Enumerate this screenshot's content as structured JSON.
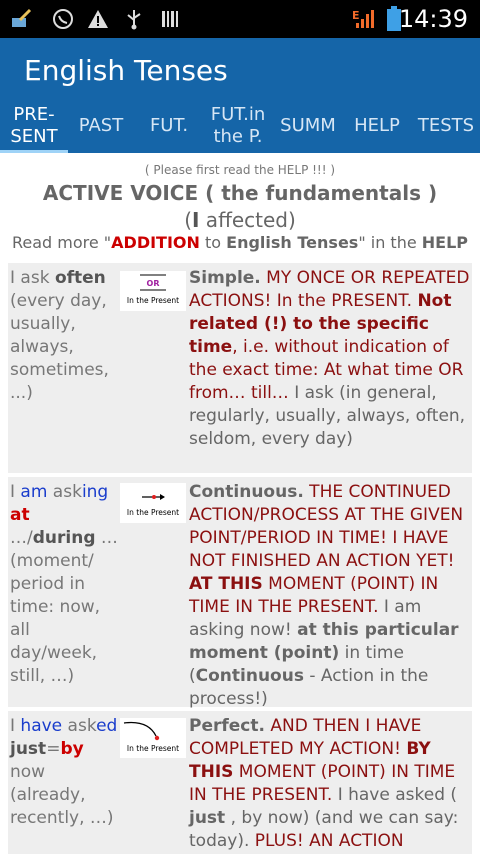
{
  "status_bar": {
    "time": "14:39",
    "icons": [
      "broom-icon",
      "whatsapp-icon",
      "warning-icon",
      "usb-icon",
      "barcode-icon",
      "signal-icon",
      "battery-icon"
    ],
    "network_label": "E"
  },
  "app_bar": {
    "title": "English Tenses",
    "tabs": [
      {
        "label": "PRE-\nSENT",
        "active": true
      },
      {
        "label": "PAST"
      },
      {
        "label": "FUT."
      },
      {
        "label": "FUT.in\nthe P."
      },
      {
        "label": "SUMM"
      },
      {
        "label": "HELP"
      },
      {
        "label": "TESTS"
      }
    ]
  },
  "content": {
    "note": "( Please first read the HELP !!! )",
    "heading": "ACTIVE VOICE ( the fundamentals )",
    "subheading_bold": "I",
    "subheading_rest": " affected)",
    "subheading_open": "(",
    "readmore": {
      "prefix": "Read more \"",
      "addition": "ADDITION",
      "to": " to ",
      "english_tenses": "English Tenses",
      "middle": "\" in the ",
      "help": "HELP"
    },
    "rows": [
      {
        "left_html": [
          "I ask ",
          "often",
          " (every day, usually, always, sometimes, ...)"
        ],
        "illustration_label": "In the Present",
        "illustration_or": "OR",
        "right": {
          "title": "Simple.",
          "text": " MY ONCE OR REPEATED ACTIONS! In the PRESENT. ",
          "bold1": "Not related (!) to the specific time",
          "text2": ", i.e. without indication of the exact time: At what time OR from… till… ",
          "gray": "I ask (in general, regularly, usually, always, often, seldom, every day)"
        }
      },
      {
        "left": {
          "p1": "I ",
          "am": "am",
          "ask": " ask",
          "ing": "ing",
          "at": "at",
          "rest": " …/",
          "during": "during",
          "rest2": " … (moment/ period in time: now, all day/week, still, …)"
        },
        "illustration_label": "In the Present",
        "right": {
          "title": "Continuous.",
          "text": " THE CONTINUED ACTION/PROCESS AT THE GIVEN POINT/PERIOD IN TIME! I HAVE NOT FINISHED AN ACTION YET! ",
          "bold1": "AT THIS",
          "text2": " MOMENT (POINT) IN TIME IN THE PRESENT. ",
          "gray1": "I am asking now! ",
          "graybold": "at this particular moment (point)",
          "gray2": " in time (",
          "graybold2": "Continuous",
          "gray3": " - Action in the process!)"
        }
      },
      {
        "left": {
          "p1": "I ",
          "have": "have",
          "ask": " ask",
          "ed": "ed",
          "just": "just",
          "eq": "=",
          "by": "by",
          "rest": " now (already, recently, …)"
        },
        "illustration_label": "In the Present",
        "right": {
          "title": "Perfect.",
          "text": " AND THEN I HAVE COMPLETED MY ACTION! ",
          "bold1": "BY THIS",
          "text2": " MOMENT (POINT) IN TIME IN THE PRESENT. ",
          "gray1": "I have asked ( ",
          "graybold": "just",
          "gray2": " , by now) (and we can say: today). ",
          "text3": "PLUS! AN ACTION"
        }
      }
    ]
  }
}
